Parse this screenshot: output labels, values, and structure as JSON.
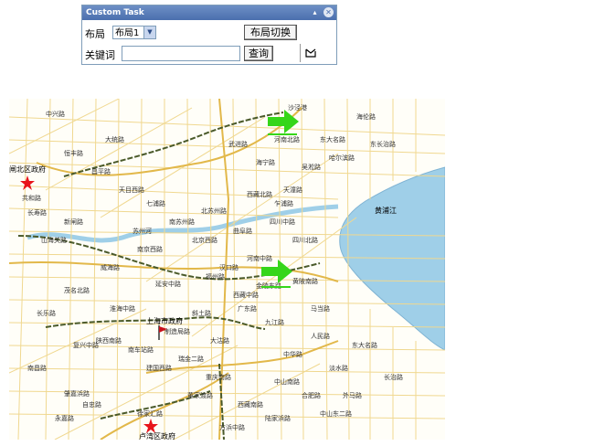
{
  "panel": {
    "title": "Custom Task",
    "collapse_glyph": "▴",
    "close_glyph": "✕",
    "layout_label": "布局",
    "layout_selected": "布局1",
    "layout_switch_button": "布局切换",
    "keyword_label": "关键词",
    "keyword_value": "",
    "search_button": "查询"
  },
  "map": {
    "water_label": "黄浦江",
    "places": [
      {
        "name": "闸北区政府",
        "icon": "red-star-icon"
      },
      {
        "name": "卢湾区政府",
        "icon": "red-star-icon"
      },
      {
        "name": "上海市政府",
        "icon": "red-flag-icon"
      }
    ],
    "arrows": [
      "green-arrow-icon",
      "green-arrow-icon"
    ],
    "road_labels": [
      "中兴路",
      "共和路",
      "天目西路",
      "北京西路",
      "南京西路",
      "延安中路",
      "淮海中路",
      "复兴中路",
      "建国西路",
      "肇嘉浜路",
      "西藏中路",
      "河南中路",
      "四川中路",
      "北苏州路",
      "武进路",
      "海宁路",
      "天潼路",
      "七浦路",
      "福州路",
      "人民路",
      "中华路",
      "徐家汇路",
      "大沽路",
      "威海路",
      "茂名北路",
      "长乐路",
      "南昌路",
      "陕西南路",
      "永嘉路",
      "东大名路",
      "吴淞路",
      "乍浦路",
      "广东路",
      "九江路",
      "汉口路",
      "金陵东路",
      "新闸路",
      "山海关路",
      "昌平路",
      "长寿路",
      "苏州河",
      "沙泾港",
      "南苏州路",
      "曲阜路",
      "大统路",
      "恒丰路",
      "西藏北路",
      "河南北路",
      "四川北路",
      "海伦路",
      "哈尔滨路",
      "东长治路",
      "长治路",
      "东大名路",
      "外马路",
      "中山东二路",
      "中山南路",
      "董家渡路",
      "陆家浜路",
      "西藏南路",
      "南车站路",
      "制造局路",
      "斜土路",
      "瑞金二路",
      "重庆南路",
      "马当路",
      "黄陂南路",
      "淡水路",
      "合肥路",
      "自忠路",
      "方浜中路",
      "蓬莱路",
      "复兴东路",
      "人民路",
      "丽园路",
      "龙华东路"
    ]
  }
}
